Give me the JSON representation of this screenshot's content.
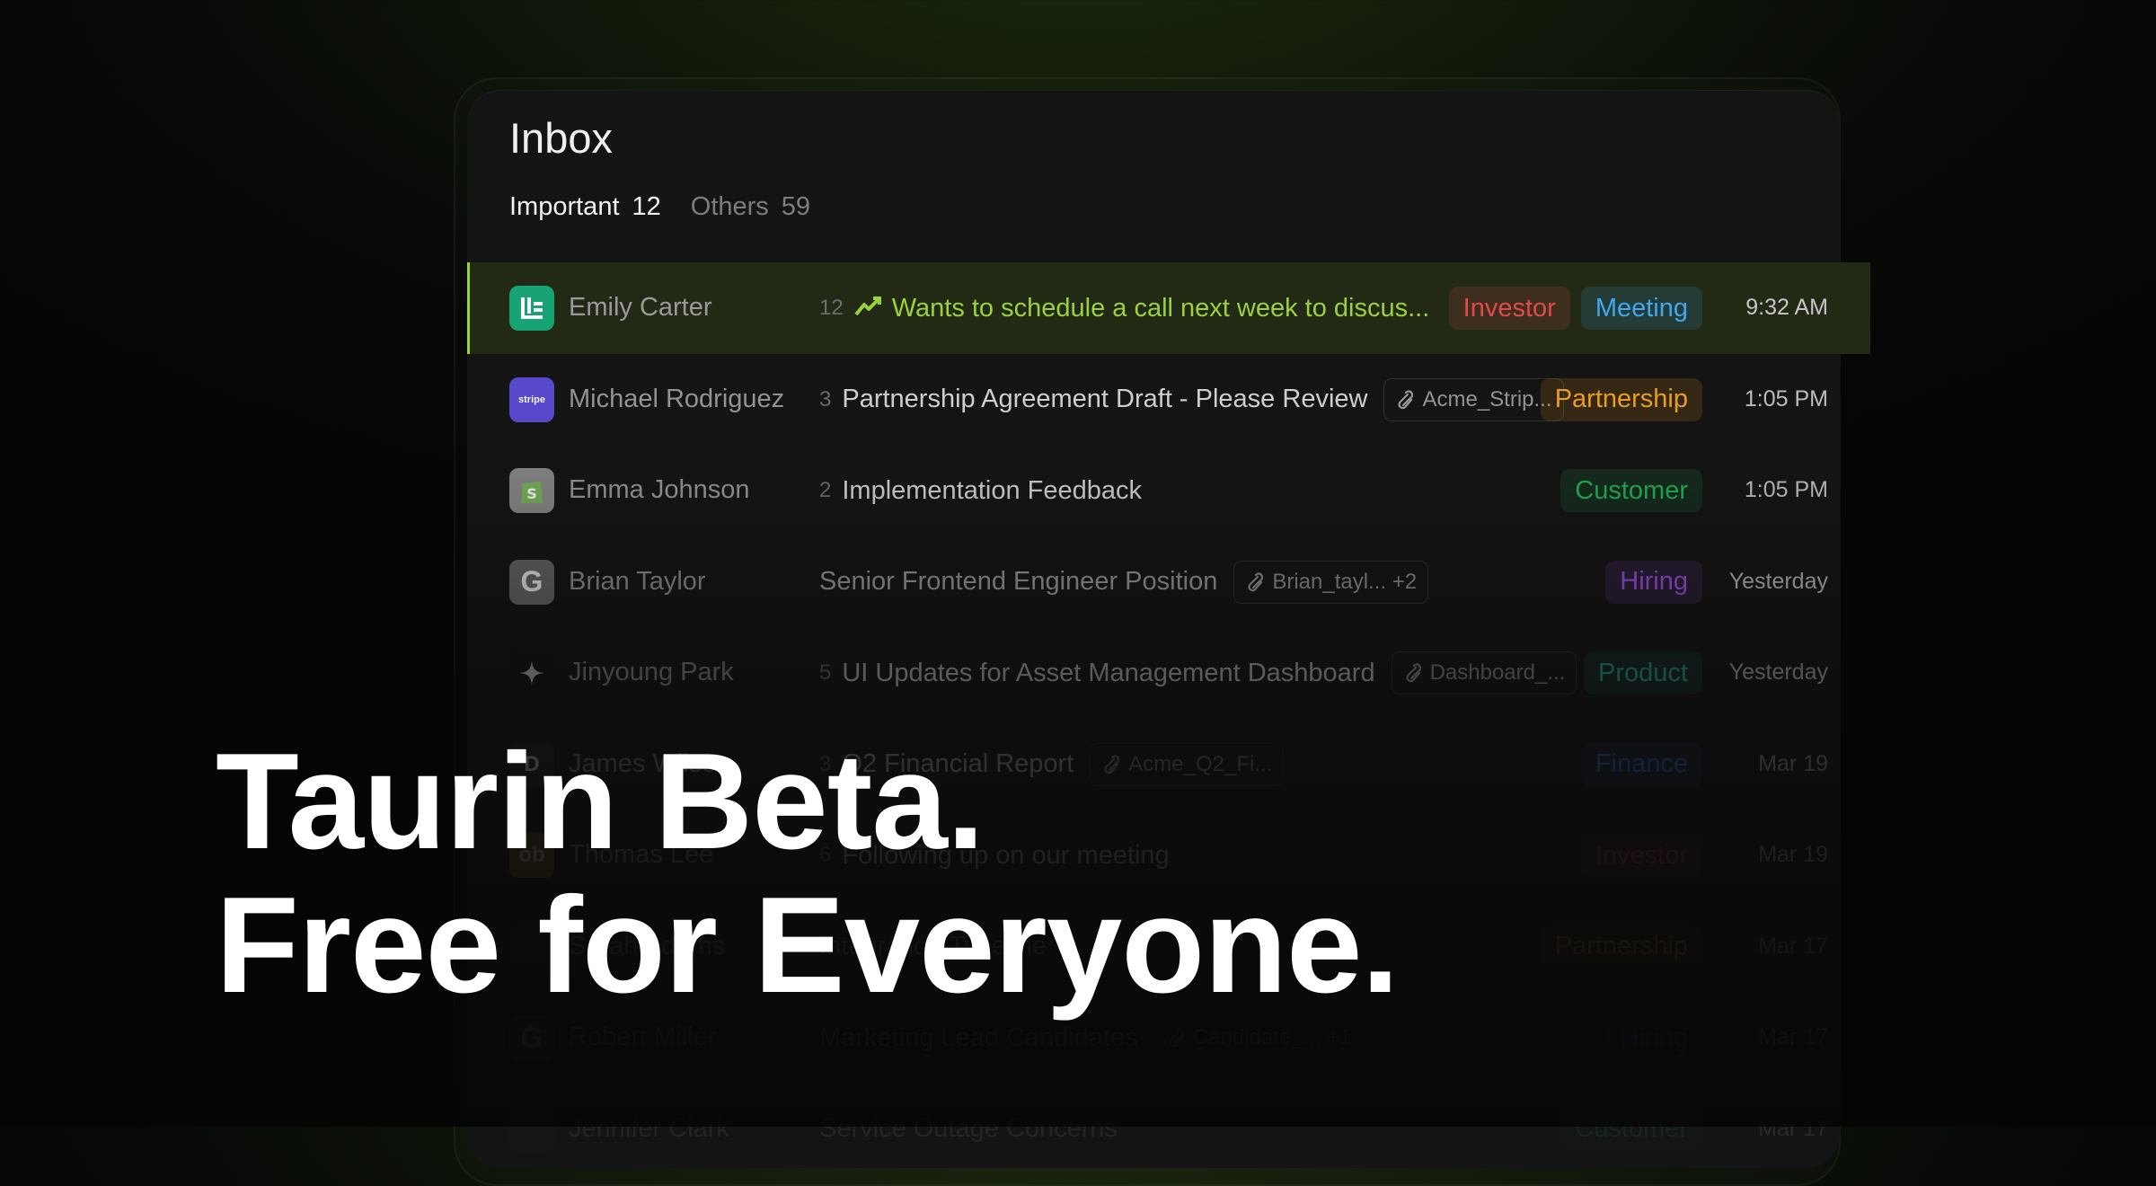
{
  "window": {
    "title": "Inbox",
    "tabs": [
      {
        "label": "Important",
        "count": "12",
        "active": true
      },
      {
        "label": "Others",
        "count": "59",
        "active": false
      }
    ]
  },
  "colors": {
    "accent": "#9bd13c",
    "tag_investor": "#e5484d",
    "tag_meeting": "#3ea8f0",
    "tag_partnership": "#f5a524",
    "tag_customer": "#22b455",
    "tag_hiring": "#a855f7",
    "tag_product": "#2bb8a3",
    "tag_finance": "#3b82f6"
  },
  "emails": [
    {
      "sender": "Emily Carter",
      "avatar_icon": "emily-carter-logo-icon",
      "avatar_color": "#17a374",
      "count": "12",
      "subject": "Wants to schedule a call next week to discus...",
      "ai_icon": "sparkle-trend-icon",
      "attachment": "",
      "tags": [
        {
          "label": "Investor",
          "kind": "investor"
        },
        {
          "label": "Meeting",
          "kind": "meeting"
        }
      ],
      "time": "9:32 AM",
      "selected": true
    },
    {
      "sender": "Michael Rodriguez",
      "avatar_icon": "stripe-logo-icon",
      "avatar_color": "#5b4bd6",
      "avatar_text": "stripe",
      "count": "3",
      "subject": "Partnership Agreement Draft - Please Review",
      "attachment": "Acme_Strip...",
      "tags": [
        {
          "label": "Partnership",
          "kind": "partnership"
        }
      ],
      "time": "1:05 PM"
    },
    {
      "sender": "Emma Johnson",
      "avatar_icon": "shopify-logo-icon",
      "avatar_color": "#8a8a8a",
      "count": "2",
      "subject": "Implementation Feedback",
      "attachment": "",
      "tags": [
        {
          "label": "Customer",
          "kind": "customer"
        }
      ],
      "time": "1:05 PM"
    },
    {
      "sender": "Brian Taylor",
      "avatar_icon": "google-logo-icon",
      "avatar_color": "#6e6e6e",
      "count": "",
      "subject": "Senior Frontend Engineer Position",
      "attachment": "Brian_tayl... +2",
      "tags": [
        {
          "label": "Hiring",
          "kind": "hiring"
        }
      ],
      "time": "Yesterday"
    },
    {
      "sender": "Jinyoung Park",
      "avatar_icon": "sparkle-logo-icon",
      "avatar_color": "#111111",
      "count": "5",
      "subject": "UI Updates for Asset Management Dashboard",
      "attachment": "Dashboard_...",
      "tags": [
        {
          "label": "Product",
          "kind": "product"
        }
      ],
      "time": "Yesterday"
    },
    {
      "sender": "James Wilson",
      "avatar_icon": "d-logo-icon",
      "avatar_color": "#2a2a2a",
      "avatar_text": "D",
      "count": "3",
      "subject": "Q2 Financial Report",
      "attachment": "Acme_Q2_Fi...",
      "tags": [
        {
          "label": "Finance",
          "kind": "finance"
        }
      ],
      "time": "Mar 19"
    },
    {
      "sender": "Thomas Lee",
      "avatar_icon": "brand-logo-icon",
      "avatar_color": "#8a5a1a",
      "avatar_text": "ob",
      "count": "6",
      "subject": "Following up on our meeting",
      "attachment": "",
      "tags": [
        {
          "label": "Investor",
          "kind": "investor"
        }
      ],
      "time": "Mar 19"
    },
    {
      "sender": "Sarah Adams",
      "avatar_icon": "company-logo-icon",
      "avatar_color": "#2a2a2a",
      "count": "",
      "subject": "Integration Timeline",
      "attachment": "",
      "tags": [
        {
          "label": "Partnership",
          "kind": "partnership"
        }
      ],
      "time": "Mar 17"
    },
    {
      "sender": "Robert Miller",
      "avatar_icon": "google-logo-icon",
      "avatar_color": "#4a4a4a",
      "count": "",
      "subject": "Marketing Lead Candidates",
      "attachment": "Candidate_... +1",
      "tags": [
        {
          "label": "Hiring",
          "kind": "hiring"
        }
      ],
      "time": "Mar 17"
    },
    {
      "sender": "Jennifer Clark",
      "avatar_icon": "company-logo-icon",
      "avatar_color": "#2a2a2a",
      "count": "",
      "subject": "Service Outage Concerns",
      "attachment": "",
      "tags": [
        {
          "label": "Customer",
          "kind": "customer"
        }
      ],
      "time": "Mar 17"
    }
  ],
  "hero": {
    "line1": "Taurin Beta.",
    "line2": "Free for Everyone."
  }
}
